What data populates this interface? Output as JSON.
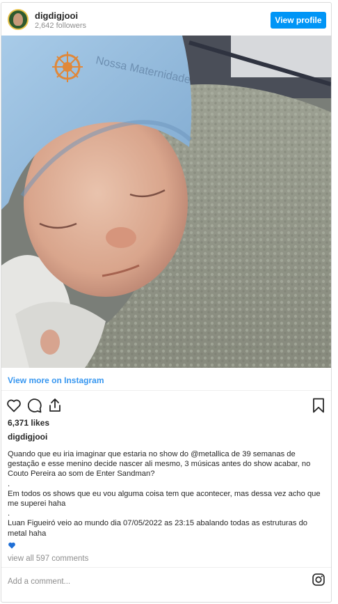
{
  "header": {
    "username": "digdigjooi",
    "followers": "2,642 followers",
    "view_profile": "View profile"
  },
  "photo": {
    "hat_text": "Nossa Maternidade"
  },
  "links": {
    "view_more": "View more on Instagram"
  },
  "stats": {
    "likes": "6,371 likes"
  },
  "caption": {
    "username": "digdigjooi",
    "line1": "Quando que eu iria imaginar que estaria no show do @metallica de 39 semanas de gestação e esse menino decide nascer ali mesmo, 3 músicas antes do show acabar, no Couto Pereira ao som de Enter Sandman?",
    "dot1": ".",
    "line2": "Em todos os shows que eu vou alguma coisa tem que acontecer, mas dessa vez acho que me superei haha",
    "dot2": ".",
    "line3": "Luan Figueiró veio ao mundo dia 07/05/2022 as 23:15 abalando todas as estruturas do metal haha"
  },
  "comments": {
    "view_all": "view all 597 comments",
    "placeholder": "Add a comment..."
  },
  "colors": {
    "accent": "#0095f6",
    "link": "#3897f0",
    "muted": "#8e8e8e",
    "heart": "#1f6fd6"
  },
  "icons": [
    "heart-icon",
    "comment-icon",
    "share-icon",
    "bookmark-icon",
    "blue-heart-icon",
    "instagram-icon"
  ]
}
